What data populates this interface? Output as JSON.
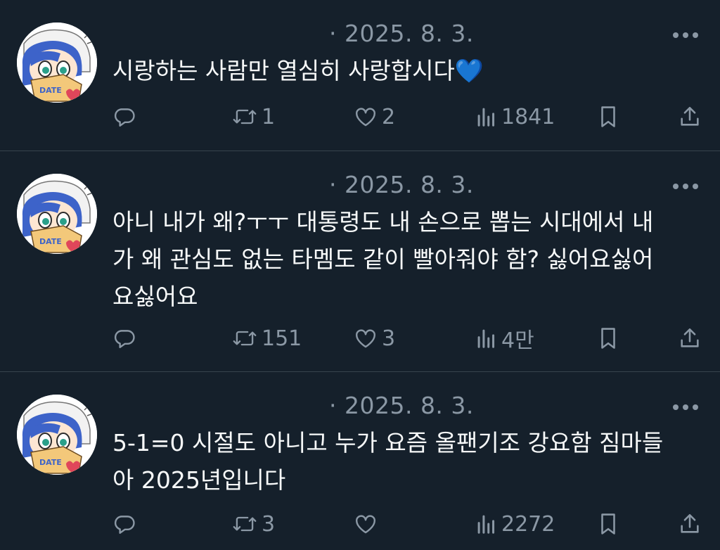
{
  "tweets": [
    {
      "date": "· 2025. 8. 3.",
      "text": "시랑하는 사람만 열심히 사랑합시다💙",
      "retweets": "1",
      "likes": "2",
      "views": "1841"
    },
    {
      "date": "· 2025. 8. 3.",
      "text": "아니 내가 왜?ㅜㅜ 대통령도 내 손으로 뽑는 시대에서 내\n가 왜 관심도 없는 타멤도 같이 빨아줘야 함? 싫어요싫어\n요싫어요",
      "retweets": "151",
      "likes": "3",
      "views": "4만"
    },
    {
      "date": "· 2025. 8. 3.",
      "text": "5-1=0 시절도 아니고 누가 요즘 올팬기조 강요함 짐마들\n아 2025년입니다",
      "retweets": "3",
      "likes": "",
      "views": "2272"
    }
  ],
  "icons": {
    "reply": "reply-icon",
    "retweet": "retweet-icon",
    "like": "heart-icon",
    "views": "views-icon",
    "bookmark": "bookmark-icon",
    "share": "share-icon",
    "more": "more-icon"
  },
  "colors": {
    "background": "#15202b",
    "text": "#f7f9f9",
    "muted": "#8b98a5",
    "divider": "#38444d"
  }
}
